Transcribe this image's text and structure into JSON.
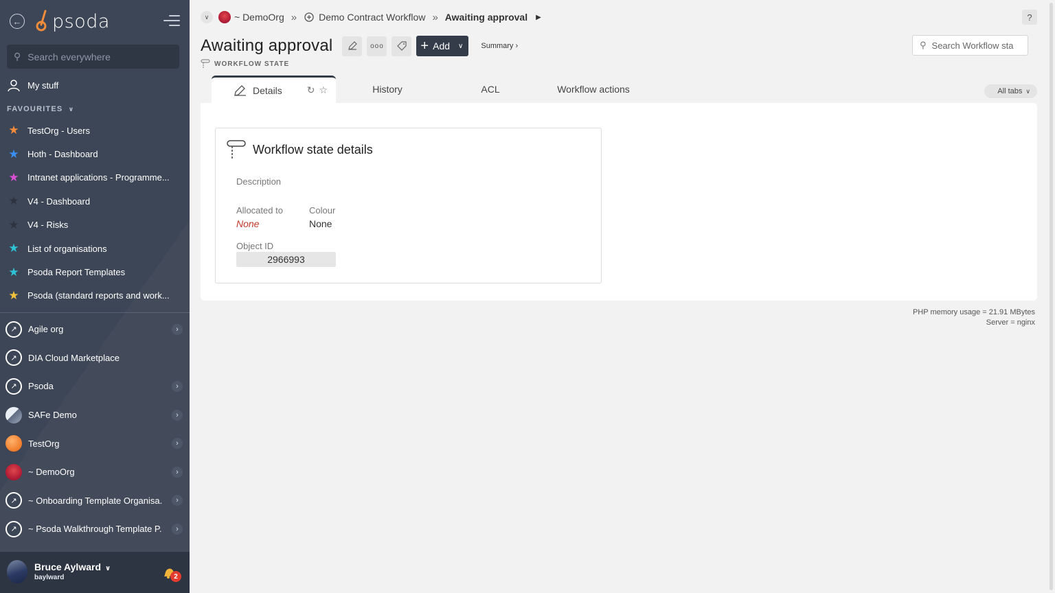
{
  "sidebar": {
    "logo_text": "psoda",
    "search_placeholder": "Search everywhere",
    "my_stuff_label": "My stuff",
    "favourites_heading": "FAVOURITES",
    "favourites": [
      {
        "label": "TestOrg - Users",
        "star_color": "#f28c3b"
      },
      {
        "label": "Hoth - Dashboard",
        "star_color": "#3b8ff2"
      },
      {
        "label": "Intranet applications - Programme...",
        "star_color": "#d84fd1"
      },
      {
        "label": "V4 - Dashboard",
        "star_color": "#2d3440"
      },
      {
        "label": "V4 - Risks",
        "star_color": "#2d3440"
      },
      {
        "label": "List of organisations",
        "star_color": "#2ec4d6"
      },
      {
        "label": "Psoda Report Templates",
        "star_color": "#2ec4d6"
      },
      {
        "label": "Psoda (standard reports and work...",
        "star_color": "#f2c23b"
      }
    ],
    "orgs": [
      {
        "label": "Agile org",
        "icon": "rocket-icon",
        "chevron": true
      },
      {
        "label": "DIA Cloud Marketplace",
        "icon": "rocket-icon",
        "chevron": false
      },
      {
        "label": "Psoda",
        "icon": "rocket-icon",
        "chevron": true
      },
      {
        "label": "SAFe Demo",
        "icon": "mountain-icon",
        "chevron": true
      },
      {
        "label": "TestOrg",
        "icon": "orange-circle-icon",
        "chevron": true
      },
      {
        "label": "~ DemoOrg",
        "icon": "sunset-icon",
        "chevron": true
      },
      {
        "label": "~ Onboarding Template Organisa...",
        "icon": "rocket-icon",
        "chevron": true
      },
      {
        "label": "~ Psoda Walkthrough Template P...",
        "icon": "rocket-icon",
        "chevron": true
      }
    ],
    "user": {
      "name": "Bruce Aylward",
      "login": "baylward",
      "notification_count": "2"
    }
  },
  "breadcrumb": {
    "org": "~ DemoOrg",
    "workflow": "Demo Contract Workflow",
    "current": "Awaiting approval"
  },
  "header": {
    "title": "Awaiting approval",
    "type_label": "WORKFLOW STATE",
    "add_label": "Add",
    "summary_label": "Summary ›",
    "search_placeholder": "Search Workflow sta",
    "help_label": "?"
  },
  "tabs": {
    "items": [
      "Details",
      "History",
      "ACL",
      "Workflow actions"
    ],
    "all_tabs_label": "All tabs"
  },
  "details_card": {
    "title": "Workflow state details",
    "description_label": "Description",
    "allocated_label": "Allocated to",
    "allocated_value": "None",
    "colour_label": "Colour",
    "colour_value": "None",
    "object_id_label": "Object ID",
    "object_id_value": "2966993"
  },
  "footer": {
    "memory": "PHP memory usage = 21.91 MBytes",
    "server": "Server = nginx"
  },
  "colors": {
    "sidebar_bg": "#3d4656",
    "dark_button": "#343c4a",
    "accent_red": "#c0392b"
  }
}
